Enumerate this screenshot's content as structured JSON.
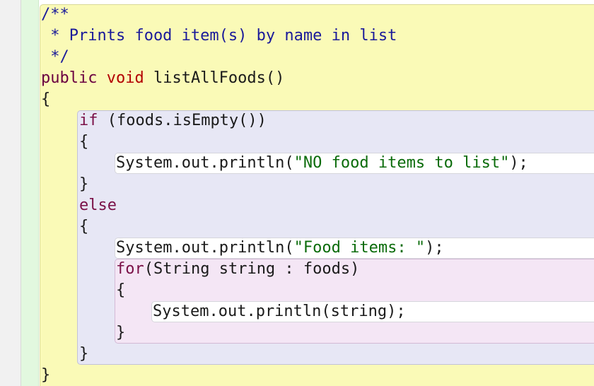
{
  "code": {
    "doc_open": "/**",
    "doc_line": " * Prints food item(s) by name in list",
    "doc_close": " */",
    "sig_modifier": "public",
    "sig_return_type": "void",
    "sig_name": "listAllFoods()",
    "method_open_brace": "{",
    "if_keyword": "if",
    "if_condition": " (foods.isEmpty())",
    "if_open_brace": "{",
    "stmt1_call": "System.out.println(",
    "stmt1_string": "\"NO food items to list\"",
    "stmt1_end": ");",
    "if_close_brace": "}",
    "else_keyword": "else",
    "else_open_brace": "{",
    "stmt2_call": "System.out.println(",
    "stmt2_string": "\"Food items: \"",
    "stmt2_end": ");",
    "for_keyword": "for",
    "for_header": "(String string : foods)",
    "for_open_brace": "{",
    "stmt3": "System.out.println(string);",
    "for_close_brace": "}",
    "else_close_brace": "}",
    "method_close_brace": "}"
  },
  "colors": {
    "class_scope": "#fafab7",
    "if_scope": "#e7e7f5",
    "for_scope": "#f4e6f5",
    "statement": "#ffffff",
    "margin_strip": "#e2f8df",
    "comment": "#1a1a9a",
    "keyword_type": "#b30000",
    "keyword_control": "#7a1047",
    "string_literal": "#0a6b0a"
  }
}
